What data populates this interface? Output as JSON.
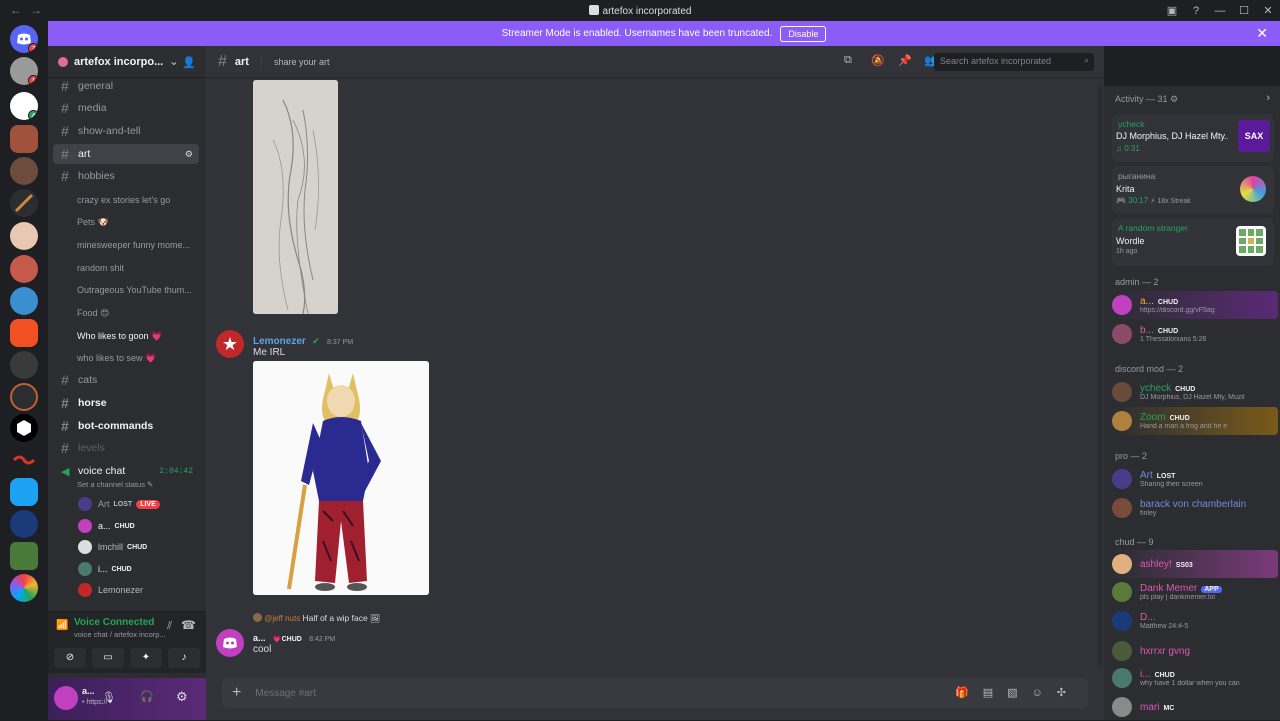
{
  "window": {
    "title": "artefox incorporated",
    "back": "←",
    "forward": "→"
  },
  "banner": {
    "text": "Streamer Mode is enabled. Usernames have been truncated.",
    "button": "Disable",
    "close": "✕"
  },
  "rail": {
    "badges": [
      "7",
      "1",
      "4"
    ]
  },
  "server": {
    "name": "artefox incorpo...",
    "chevron": "⌄"
  },
  "channels": [
    {
      "name": "general",
      "type": "text"
    },
    {
      "name": "media",
      "type": "text"
    },
    {
      "name": "show-and-tell",
      "type": "text"
    },
    {
      "name": "art",
      "type": "text",
      "active": true
    },
    {
      "name": "hobbies",
      "type": "text"
    },
    {
      "name": "cats",
      "type": "text"
    },
    {
      "name": "horse",
      "type": "text",
      "bold": true
    },
    {
      "name": "bot-commands",
      "type": "text",
      "bold": true
    },
    {
      "name": "levels",
      "type": "text",
      "muted": true
    }
  ],
  "threads": [
    "crazy ex stories let's go",
    "Pets 🐶",
    "minesweeper funny mome...",
    "random shit",
    "Outrageous YouTube thum...",
    "Food 😍",
    "Who likes to goon 💗",
    "who likes to sew 💗"
  ],
  "voice_channel": {
    "name": "voice chat",
    "timer": "2:04:42",
    "status": "Set a channel status ✎"
  },
  "voice_users": [
    {
      "name": "Art",
      "tag": "LOST",
      "live": "LIVE"
    },
    {
      "name": "a...",
      "tag": "CHUD"
    },
    {
      "name": "lmchill",
      "tag": "CHUD"
    },
    {
      "name": "i...",
      "tag": "CHUD"
    },
    {
      "name": "Lemonezer",
      "tag": ""
    }
  ],
  "voice_panel": {
    "status": "Voice Connected",
    "sub": "voice chat / artefox incorp..."
  },
  "user_bar": {
    "name": "a...",
    "sub": "• https://"
  },
  "chat": {
    "channel": "art",
    "topic": "share your art",
    "search_placeholder": "Search artefox incorporated",
    "messages": [
      {
        "author": "Lemonezer",
        "time": "8:37 PM",
        "text": "Me IRL"
      },
      {
        "reply_to": "@jeff nuts",
        "reply_text": "Half of a wip face",
        "author": "a...",
        "tag": "CHUD",
        "time": "8:42 PM",
        "text": "cool"
      }
    ],
    "composer_placeholder": "Message #art"
  },
  "activity": {
    "header": "Activity — 31",
    "items": [
      {
        "user": "ycheck",
        "title": "DJ Morphius, DJ Hazel Mty...",
        "meta": "0:31"
      },
      {
        "user": "рыганина",
        "title": "Krita",
        "meta": "30:17",
        "extra": "18x Streak"
      },
      {
        "user": "A random stranger",
        "title": "Wordle",
        "meta": "1h ago"
      }
    ]
  },
  "member_groups": [
    {
      "header": "admin — 2",
      "members": [
        {
          "name": "a...",
          "tag": "CHUD",
          "status": "https://discord.gg/vF5ag"
        },
        {
          "name": "b...",
          "tag": "CHUD",
          "status": "1 Thessalonians 5:26"
        }
      ]
    },
    {
      "header": "discord mod — 2",
      "members": [
        {
          "name": "ycheck",
          "tag": "CHUD",
          "status": "DJ Morphius, DJ Hazel Mty, Muzil"
        },
        {
          "name": "Zoom",
          "tag": "CHUD",
          "status": "Hand a man a frog and he e"
        }
      ]
    },
    {
      "header": "pro — 2",
      "members": [
        {
          "name": "Art",
          "tag": "LOST",
          "status": "Sharing their screen"
        },
        {
          "name": "barack von chamberlain",
          "tag": "",
          "status": "finley"
        }
      ]
    },
    {
      "header": "chud — 9",
      "members": [
        {
          "name": "ashley!",
          "tag": "SS03",
          "status": ""
        },
        {
          "name": "Dank Memer",
          "tag": "APP",
          "status": "pls play | dankmemer.lol"
        },
        {
          "name": "D...",
          "tag": "",
          "status": "Matthew 24:4-5"
        },
        {
          "name": "hxrrxr gvng",
          "tag": "",
          "status": ""
        },
        {
          "name": "i...",
          "tag": "CHUD",
          "status": "why have 1 dollar when you can"
        },
        {
          "name": "mari",
          "tag": "MC",
          "status": ""
        }
      ]
    }
  ],
  "colors": {
    "accent": "#5865f2",
    "banner": "#8b5cf6",
    "green": "#23a55a",
    "red": "#f23f43",
    "link": "#00a8fc",
    "mod": "#f0b232",
    "pro": "#7289da"
  }
}
